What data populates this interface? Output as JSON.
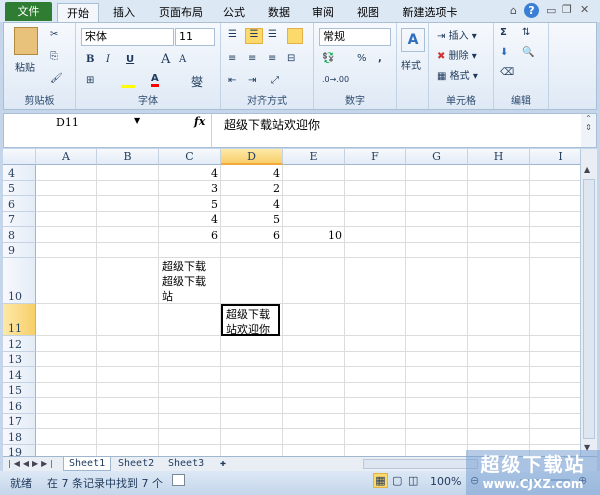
{
  "tabs": {
    "file": "文件",
    "home": "开始",
    "insert": "插入",
    "layout": "页面布局",
    "formulas": "公式",
    "data": "数据",
    "review": "审阅",
    "view": "视图",
    "newtab": "新建选项卡"
  },
  "ribbon": {
    "clipboard": {
      "label": "剪贴板",
      "paste": "粘贴"
    },
    "font": {
      "label": "字体",
      "name": "宋体",
      "size": "11",
      "bold": "B",
      "italic": "I",
      "underline": "U",
      "grow": "A",
      "shrink": "A",
      "phonetic": "燮",
      "highlight_color": "#ffff00",
      "font_color": "#ff0000"
    },
    "alignment": {
      "label": "对齐方式"
    },
    "number": {
      "label": "数字",
      "format": "常规",
      "percent": "%",
      "comma": ","
    },
    "styles": {
      "label": "样式"
    },
    "cells": {
      "label": "单元格",
      "insert": "插入",
      "delete": "删除",
      "format": "格式"
    },
    "editing": {
      "label": "编辑",
      "sum": "Σ"
    }
  },
  "formula_bar": {
    "name_box": "D11",
    "fx": "fx",
    "content": "超级下载站欢迎你"
  },
  "grid": {
    "columns": [
      "A",
      "B",
      "C",
      "D",
      "E",
      "F",
      "G",
      "H",
      "I"
    ],
    "selected_column": "D",
    "rows": [
      "4",
      "5",
      "6",
      "7",
      "8",
      "9",
      "10",
      "11",
      "12",
      "13",
      "14",
      "15",
      "16",
      "17",
      "18",
      "19"
    ],
    "selected_row": "11",
    "cells": [
      {
        "ref": "C4",
        "value": "4",
        "type": "num"
      },
      {
        "ref": "D4",
        "value": "4",
        "type": "num"
      },
      {
        "ref": "C5",
        "value": "3",
        "type": "num"
      },
      {
        "ref": "D5",
        "value": "2",
        "type": "num"
      },
      {
        "ref": "C6",
        "value": "5",
        "type": "num"
      },
      {
        "ref": "D6",
        "value": "4",
        "type": "num"
      },
      {
        "ref": "C7",
        "value": "4",
        "type": "num"
      },
      {
        "ref": "D7",
        "value": "5",
        "type": "num"
      },
      {
        "ref": "C8",
        "value": "6",
        "type": "num"
      },
      {
        "ref": "D8",
        "value": "6",
        "type": "num"
      },
      {
        "ref": "E8",
        "value": "10",
        "type": "num"
      },
      {
        "ref": "C10",
        "value": "超级下载超级下载站",
        "type": "text"
      },
      {
        "ref": "D11",
        "value": "超级下载站欢迎你",
        "type": "text"
      }
    ],
    "active_cell": "D11"
  },
  "sheets": {
    "tabs": [
      "Sheet1",
      "Sheet2",
      "Sheet3"
    ],
    "active": "Sheet1"
  },
  "status": {
    "ready": "就绪",
    "message": "在 7 条记录中找到 7 个",
    "zoom": "100%"
  },
  "watermark": {
    "title": "超级下载站",
    "url": "www.CJXZ.com"
  }
}
